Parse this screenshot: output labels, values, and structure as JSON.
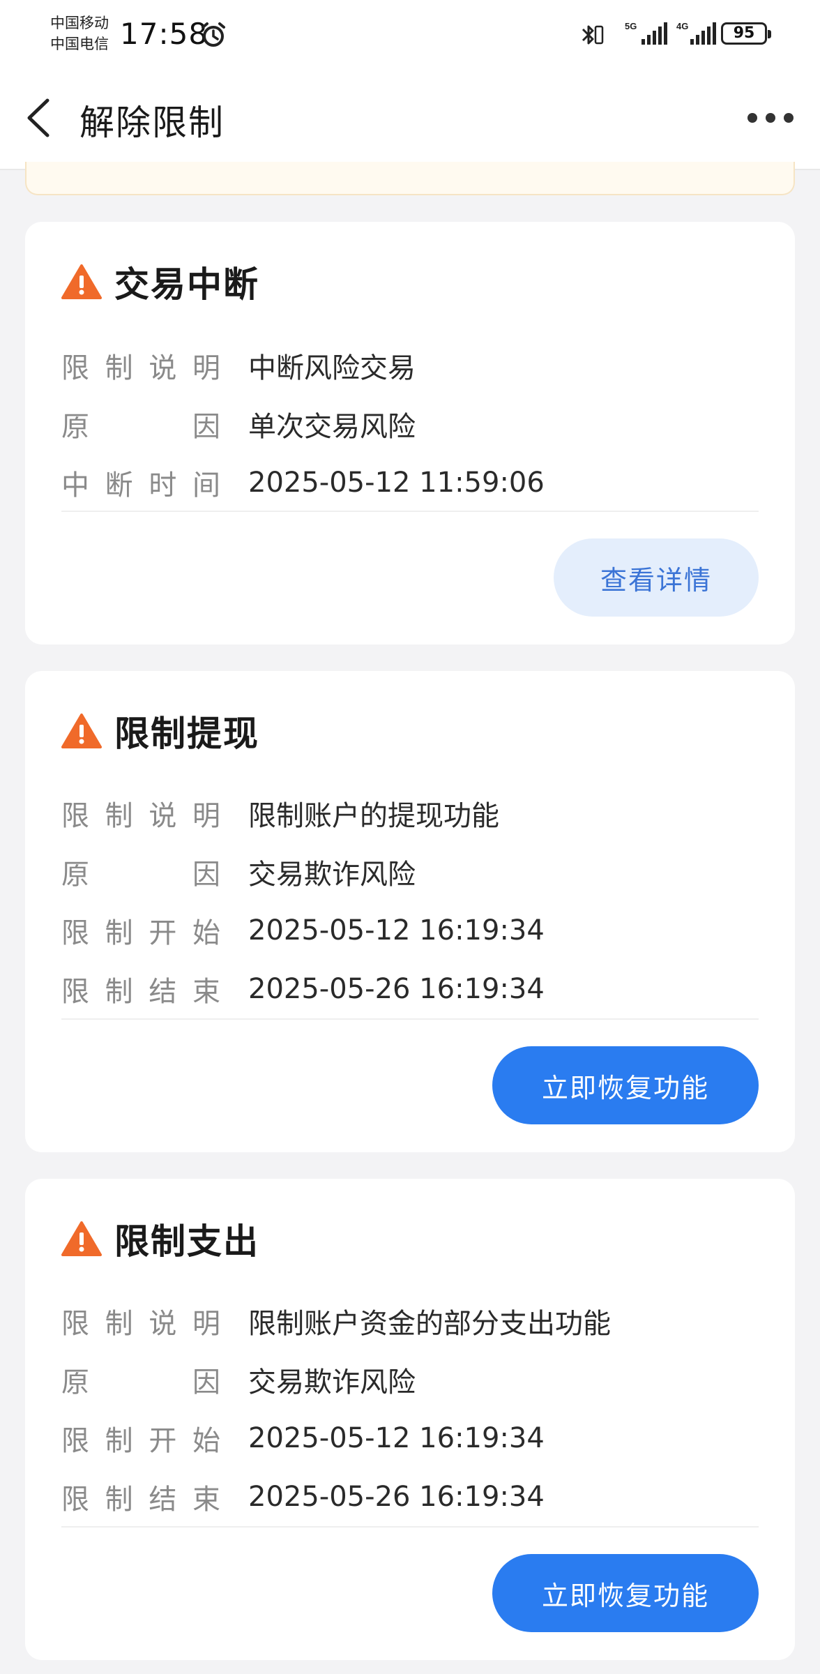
{
  "status_bar": {
    "carrier_1": "中国移动",
    "carrier_2": "中国电信",
    "time": "17:58",
    "net_5g": "5G",
    "net_4g": "4G",
    "battery": "95"
  },
  "nav": {
    "title": "解除限制"
  },
  "colors": {
    "warning": "#f06a2a",
    "primary_button": "#2a7cf0",
    "light_button_bg": "#e4eefc",
    "light_button_text": "#3b74d6"
  },
  "cards": [
    {
      "title": "交易中断",
      "icon": "warning-icon",
      "rows": [
        {
          "label": [
            "限",
            "制",
            "说",
            "明"
          ],
          "value": "中断风险交易"
        },
        {
          "label": [
            "原",
            "因"
          ],
          "value": "单次交易风险"
        },
        {
          "label": [
            "中",
            "断",
            "时",
            "间"
          ],
          "value": "2025-05-12 11:59:06"
        }
      ],
      "button": "查看详情"
    },
    {
      "title": "限制提现",
      "icon": "warning-icon",
      "rows": [
        {
          "label": [
            "限",
            "制",
            "说",
            "明"
          ],
          "value": "限制账户的提现功能"
        },
        {
          "label": [
            "原",
            "因"
          ],
          "value": "交易欺诈风险"
        },
        {
          "label": [
            "限",
            "制",
            "开",
            "始"
          ],
          "value": "2025-05-12 16:19:34"
        },
        {
          "label": [
            "限",
            "制",
            "结",
            "束"
          ],
          "value": "2025-05-26 16:19:34"
        }
      ],
      "button": "立即恢复功能"
    },
    {
      "title": "限制支出",
      "icon": "warning-icon",
      "rows": [
        {
          "label": [
            "限",
            "制",
            "说",
            "明"
          ],
          "value": "限制账户资金的部分支出功能"
        },
        {
          "label": [
            "原",
            "因"
          ],
          "value": "交易欺诈风险"
        },
        {
          "label": [
            "限",
            "制",
            "开",
            "始"
          ],
          "value": "2025-05-12 16:19:34"
        },
        {
          "label": [
            "限",
            "制",
            "结",
            "束"
          ],
          "value": "2025-05-26 16:19:34"
        }
      ],
      "button": "立即恢复功能"
    }
  ]
}
